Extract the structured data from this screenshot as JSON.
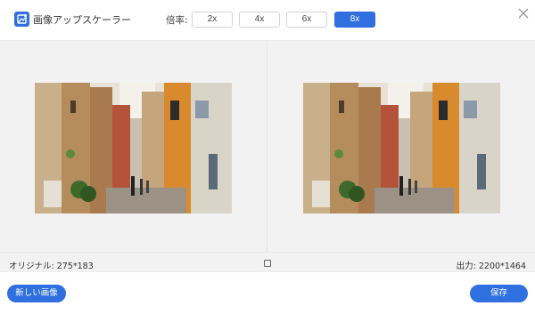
{
  "app": {
    "title": "画像アップスケーラー",
    "icon": "image-enhance-icon"
  },
  "scale": {
    "label": "倍率:",
    "options": [
      "2x",
      "4x",
      "6x",
      "8x"
    ],
    "selected": "8x"
  },
  "window": {
    "close_icon": "close-icon"
  },
  "info": {
    "original": "オリジナル: 275*183",
    "output": "出力: 2200*1464",
    "compare_icon": "square-icon"
  },
  "footer": {
    "new_image_label": "新しい画像",
    "save_label": "保存"
  },
  "colors": {
    "accent": "#2f6fe0"
  }
}
